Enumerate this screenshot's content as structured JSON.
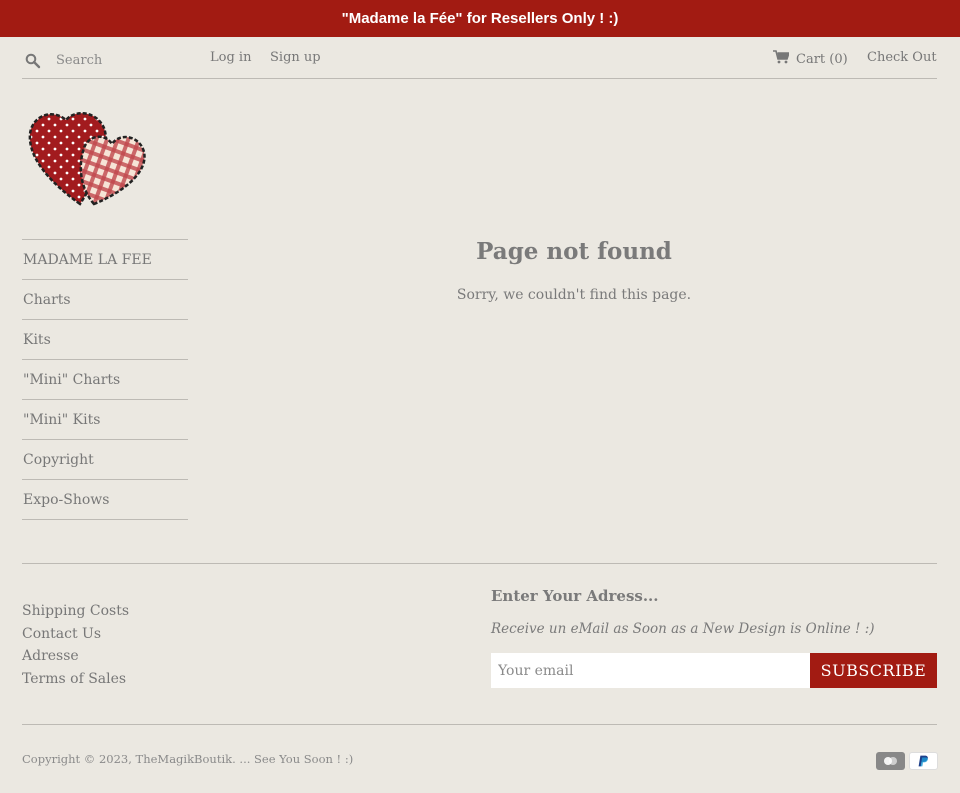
{
  "announcement": "\"Madame la Fée\" for Resellers Only ! :)",
  "header": {
    "search_placeholder": "Search",
    "login": "Log in",
    "signup": "Sign up",
    "cart": "Cart (0)",
    "checkout": "Check Out"
  },
  "sidebar": {
    "items": [
      {
        "label": "MADAME LA FEE"
      },
      {
        "label": "Charts"
      },
      {
        "label": "Kits"
      },
      {
        "label": "\"Mini\" Charts"
      },
      {
        "label": "\"Mini\" Kits"
      },
      {
        "label": "Copyright"
      },
      {
        "label": "Expo-Shows"
      }
    ]
  },
  "main": {
    "title": "Page not found",
    "message": "Sorry, we couldn't find this page."
  },
  "footer": {
    "links": [
      "Shipping Costs",
      "Contact Us",
      "Adresse",
      "Terms of Sales"
    ],
    "newsletter_title": "Enter Your Adress...",
    "newsletter_subtitle": "Receive un eMail as Soon as a New Design is Online ! :)",
    "email_placeholder": "Your email",
    "subscribe": "SUBSCRIBE",
    "copyright": "Copyright © 2023, TheMagikBoutik. ... See You Soon ! :)"
  },
  "icons": {
    "search": "search-icon",
    "cart": "cart-icon",
    "logo": "hearts-logo",
    "payment": [
      "credit-card-icon",
      "paypal-icon"
    ]
  },
  "colors": {
    "accent": "#a21b12",
    "background": "#ebe8e1",
    "text": "#777777"
  }
}
